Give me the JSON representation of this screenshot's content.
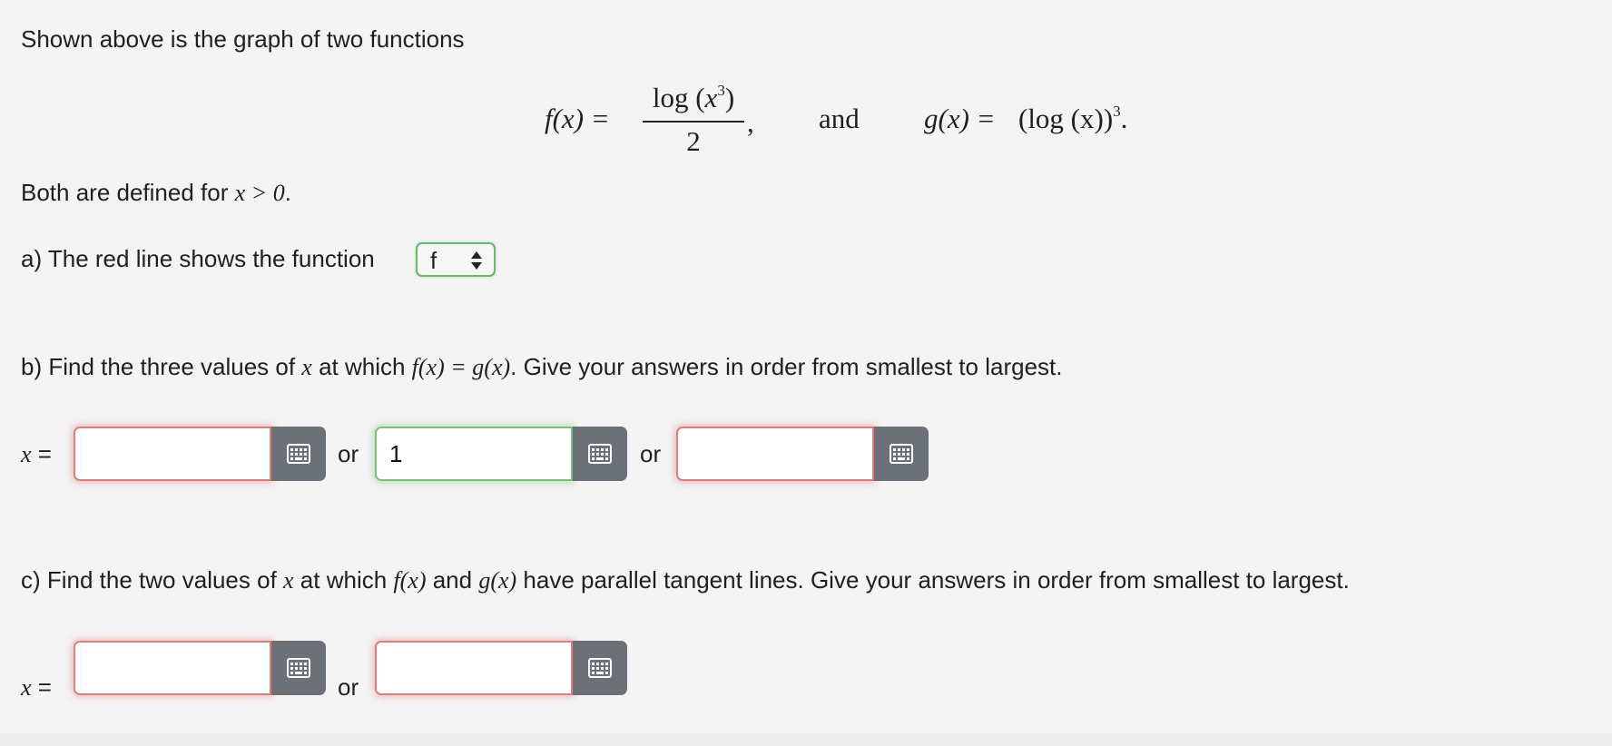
{
  "intro": {
    "text": "Shown above is the graph of two functions"
  },
  "equation": {
    "f_lhs": "f(x) =",
    "f_num_log": "log (",
    "f_num_var": "x",
    "f_num_exp": "3",
    "f_num_close": ")",
    "f_den": "2",
    "comma": ",",
    "conj": "and",
    "g_lhs": "g(x) =",
    "g_body": "(log (x))",
    "g_exp": "3",
    "period": "."
  },
  "domain_note": {
    "prefix": "Both are defined for ",
    "math": "x > 0",
    "suffix": "."
  },
  "part_a": {
    "text": "a) The red line shows the function",
    "select_value": "f"
  },
  "part_b": {
    "pre": "b) Find the three values of ",
    "var": "x",
    "mid": " at which ",
    "eq": "f(x) = g(x)",
    "post": ". Give your answers in order from smallest to largest.",
    "x_label": "x",
    "eq_sign": " =",
    "or_label": "or",
    "answers": [
      "",
      "1",
      ""
    ],
    "answer_status": [
      "incorrect",
      "correct",
      "incorrect"
    ]
  },
  "part_c": {
    "pre": "c) Find the two values of ",
    "var": "x",
    "mid1": " at which ",
    "f": "f(x)",
    "and": " and ",
    "g": "g(x)",
    "post": " have parallel tangent lines. Give your answers in order from smallest to largest.",
    "x_label": "x",
    "eq_sign": " =",
    "or_label": "or",
    "answers": [
      "",
      ""
    ],
    "answer_status": [
      "incorrect",
      "incorrect"
    ]
  },
  "colors": {
    "incorrect_border": "#d9807f",
    "correct_border": "#7cbf7c",
    "keypad_button": "#6b7177",
    "background": "#f4f4f4"
  },
  "icons": {
    "keypad": "keypad-grid-icon",
    "select_arrows": "up-down-arrows-icon"
  }
}
